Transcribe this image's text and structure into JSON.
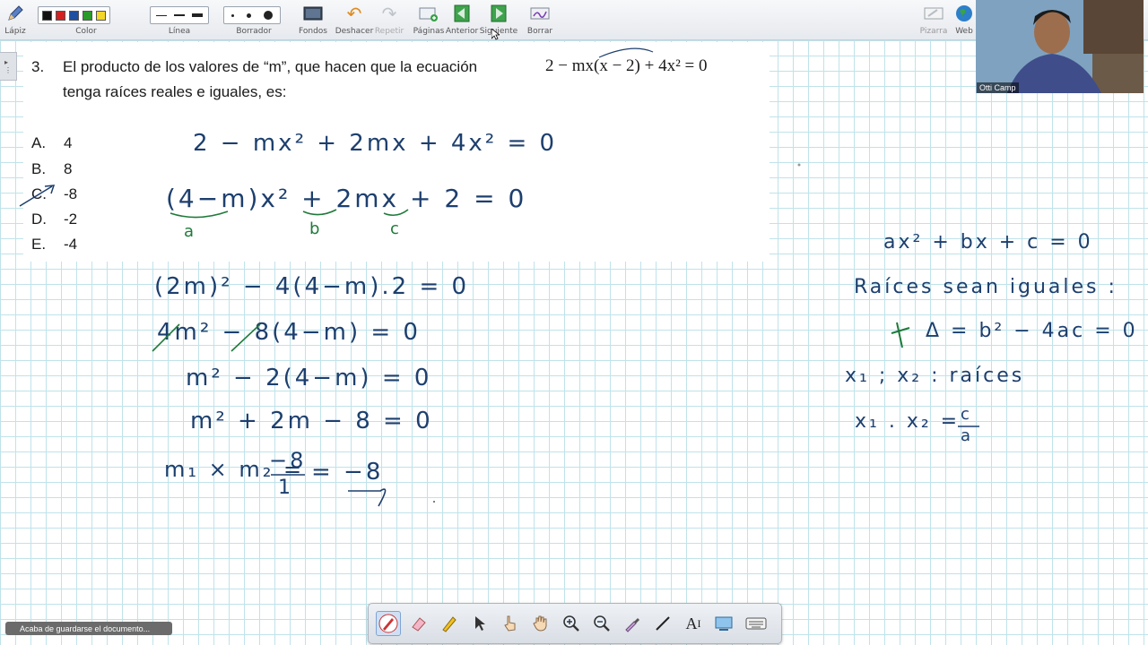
{
  "toolbar": {
    "pencil_label": "Lápiz",
    "color_label": "Color",
    "line_label": "Línea",
    "eraser_label": "Borrador",
    "backgrounds_label": "Fondos",
    "undo_label": "Deshacer",
    "redo_label": "Repetir",
    "pages_label": "Páginas",
    "previous_label": "Anterior",
    "next_label": "Siguiente",
    "clear_label": "Borrar",
    "board_label": "Pizarra",
    "web_label": "Web",
    "colors": [
      "#111111",
      "#d42020",
      "#1f4fa0",
      "#2a9a2a",
      "#f2d62a"
    ]
  },
  "problem": {
    "number": "3.",
    "line1_text": "El producto de los valores de “m”, que hacen que la ecuación",
    "line1_math": "2 − mx(x − 2) + 4x² = 0",
    "line2_text": "tenga raíces reales e iguales, es:",
    "options": [
      {
        "letter": "A.",
        "value": "4"
      },
      {
        "letter": "B.",
        "value": "8"
      },
      {
        "letter": "C.",
        "value": "-8"
      },
      {
        "letter": "D.",
        "value": "-2"
      },
      {
        "letter": "E.",
        "value": "-4"
      }
    ]
  },
  "handwriting": {
    "step1": "2 − mx² + 2mx + 4x² = 0",
    "step2": "(4−m)x² + 2mx + 2 = 0",
    "label_a": "a",
    "label_b": "b",
    "label_c": "c",
    "step3": "(2m)² − 4(4−m).2 = 0",
    "step4": "4m² − 8(4−m) = 0",
    "step5": "m² − 2(4−m) = 0",
    "step6": "m² + 2m − 8 = 0",
    "step7_left": "m₁ × m₂ =",
    "step7_num": "−8",
    "step7_den": "1",
    "step7_result": "= −8",
    "side1": "ax² + bx + c = 0",
    "side2": "Raíces sean iguales :",
    "side3": "Δ = b² − 4ac = 0",
    "side4": "x₁ ; x₂ : raíces",
    "side5_left": "x₁ . x₂ =",
    "side5_num": "c",
    "side5_den": "a"
  },
  "webcam": {
    "name": "Otti Camp"
  },
  "status": {
    "toast": "Acaba de guardarse el documento..."
  },
  "bottom_tools": [
    "pen-tool-icon",
    "highlighter-eraser-icon",
    "marker-icon",
    "pointer-icon",
    "hand-pointer-icon",
    "pan-hand-icon",
    "zoom-in-icon",
    "zoom-out-icon",
    "pipette-icon",
    "line-tool-icon",
    "text-tool-icon",
    "screen-capture-icon",
    "keyboard-icon"
  ]
}
